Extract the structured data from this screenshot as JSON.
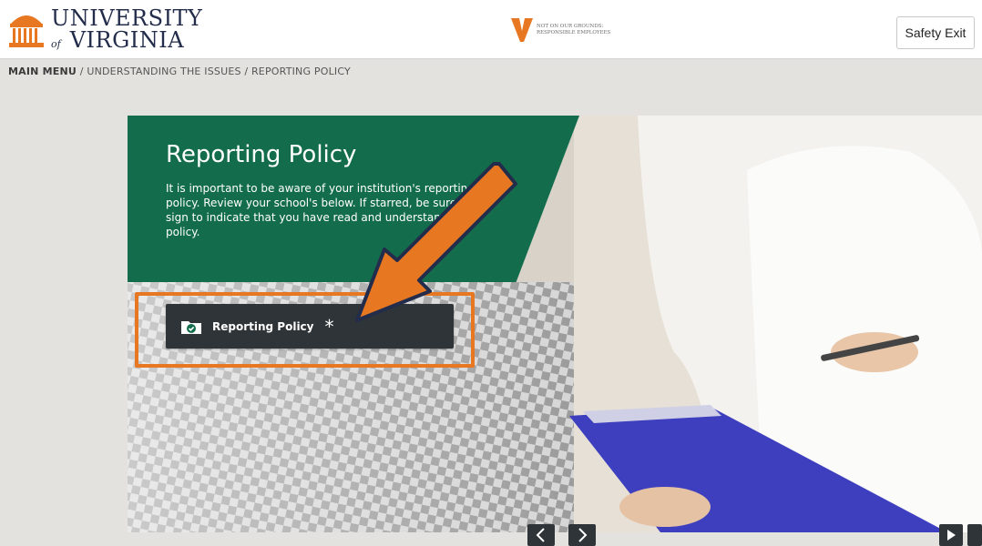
{
  "header": {
    "uva_logo": {
      "line1": "UNIVERSITY",
      "of": "of",
      "line2": "VIRGINIA"
    },
    "center_logo": {
      "line1": "NOT ON OUR GROUNDS:",
      "line2": "RESPONSIBLE EMPLOYEES"
    },
    "safety_exit_label": "Safety Exit"
  },
  "breadcrumb": {
    "main": "MAIN MENU",
    "separator": " / ",
    "items": [
      "UNDERSTANDING THE ISSUES",
      "REPORTING POLICY"
    ]
  },
  "slide": {
    "title": "Reporting Policy",
    "body": "It is important to be aware of your institution's reporting policy. Review your school's below. If starred, be sure to e-sign to indicate that you have read and understand the policy.",
    "button_label": "Reporting Policy",
    "button_star": "*"
  },
  "colors": {
    "uva_navy": "#232d4b",
    "uva_orange": "#e87722",
    "panel_green": "#136d4c",
    "button_dark": "#2e3438"
  },
  "icons": {
    "header_left": "uva-rotunda-icon",
    "header_center": "v-logo-icon",
    "button": "folder-check-icon",
    "prev": "chevron-left-icon",
    "next": "chevron-right-icon",
    "play": "play-icon"
  }
}
